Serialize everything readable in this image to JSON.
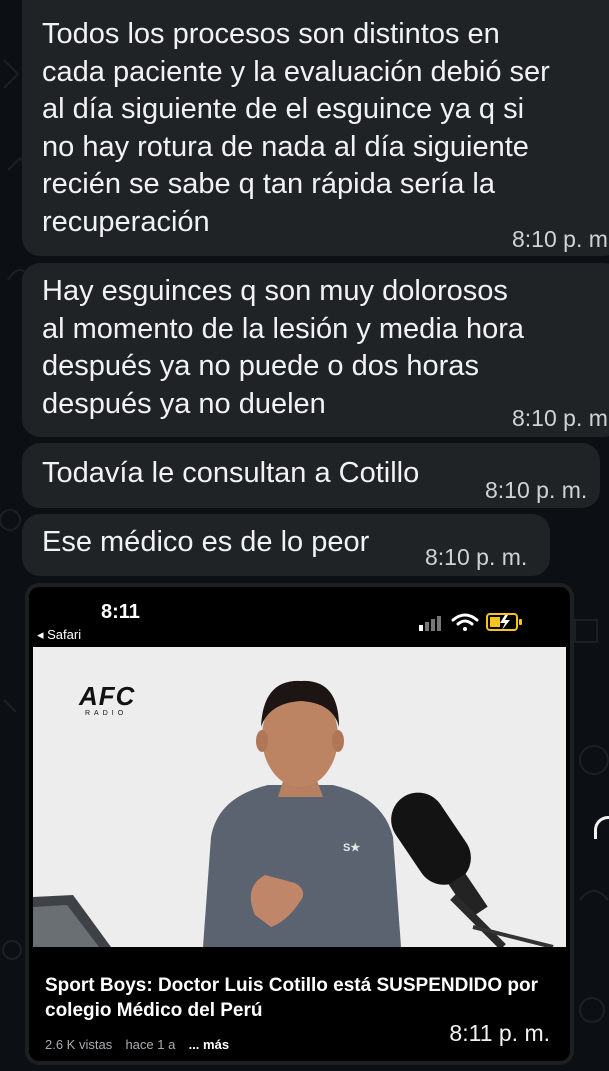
{
  "chat": {
    "messages": [
      {
        "text": "Todos los procesos son distintos en\ncada paciente y la evaluación debió ser\nal día siguiente de el esguince ya q si\nno hay rotura de nada al día siguiente\nrecién se sabe q tan rápida sería la\nrecuperación",
        "time": "8:10 p. m"
      },
      {
        "text": "Hay esguinces q son muy dolorosos\nal momento de la lesión y media hora\ndespués ya no puede o dos horas\ndespués ya no duelen",
        "time": "8:10 p. m"
      },
      {
        "text": "Todavía le consultan a Cotillo",
        "time": "8:10 p. m."
      },
      {
        "text": "Ese médico es de lo peor",
        "time": "8:10 p. m."
      }
    ],
    "media": {
      "status_time": "8:11",
      "back_label": "◂ Safari",
      "logo_text": "AFC",
      "logo_sub": "RADIO",
      "jersey_logo": "S★",
      "title": "Sport Boys: Doctor Luis Cotillo está SUSPENDIDO por colegio Médico del Perú",
      "views": "2.6 K vistas",
      "age": "hace 1 a",
      "more": "... más",
      "time": "8:11 p. m."
    }
  },
  "colors": {
    "background": "#0c1014",
    "bubble": "#1f2326",
    "battery": "#f5c518"
  },
  "icons": [
    "signal-icon",
    "wifi-icon",
    "battery-charging-icon",
    "share-arrow-icon"
  ]
}
